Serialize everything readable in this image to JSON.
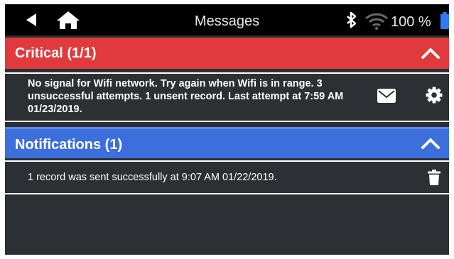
{
  "status_bar": {
    "title": "Messages",
    "battery_percent": "100 %",
    "icons": [
      "back-arrow-icon",
      "home-icon",
      "bluetooth-icon",
      "wifi-icon",
      "battery-icon"
    ]
  },
  "critical": {
    "header_label": "Critical  (1/1)",
    "color": "#e03a3c",
    "messages": [
      {
        "text": "No signal for Wifi network. Try again when Wifi is in range. 3 unsuccessful attempts. 1 unsent record. Last attempt at 7:59 AM 01/23/2019.",
        "actions": [
          "mail-icon",
          "gear-icon"
        ]
      }
    ]
  },
  "notifications": {
    "header_label": "Notifications  (1)",
    "color": "#3d6fdc",
    "messages": [
      {
        "text": "1 record was sent successfully at 9:07 AM 01/22/2019.",
        "actions": [
          "trash-icon"
        ]
      }
    ]
  }
}
